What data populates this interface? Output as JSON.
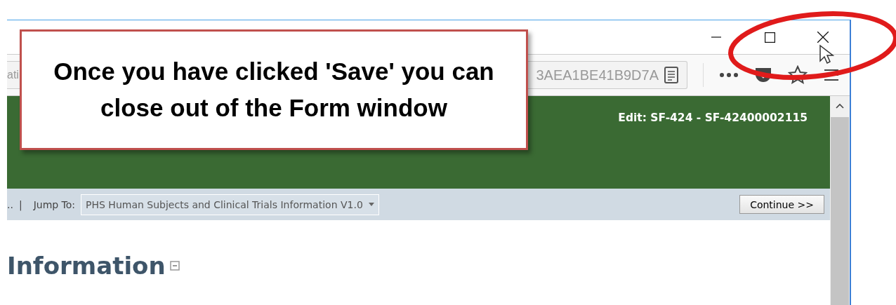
{
  "address_bar": {
    "visible_start": "ati",
    "visible_end": "3AEA1BE41B9D7A"
  },
  "page_header": {
    "title": "Edit: SF-424 - SF-42400002115"
  },
  "nav_bar": {
    "breadcrumb_end": "..",
    "separator": "|",
    "jump_label": "Jump To:",
    "jump_value": "PHS Human Subjects and Clinical Trials Information V1.0",
    "continue_button": "Continue >>"
  },
  "section": {
    "heading": "Information",
    "expanded": true
  },
  "callout": {
    "text": "Once you have clicked 'Save' you can close out of the Form window"
  }
}
